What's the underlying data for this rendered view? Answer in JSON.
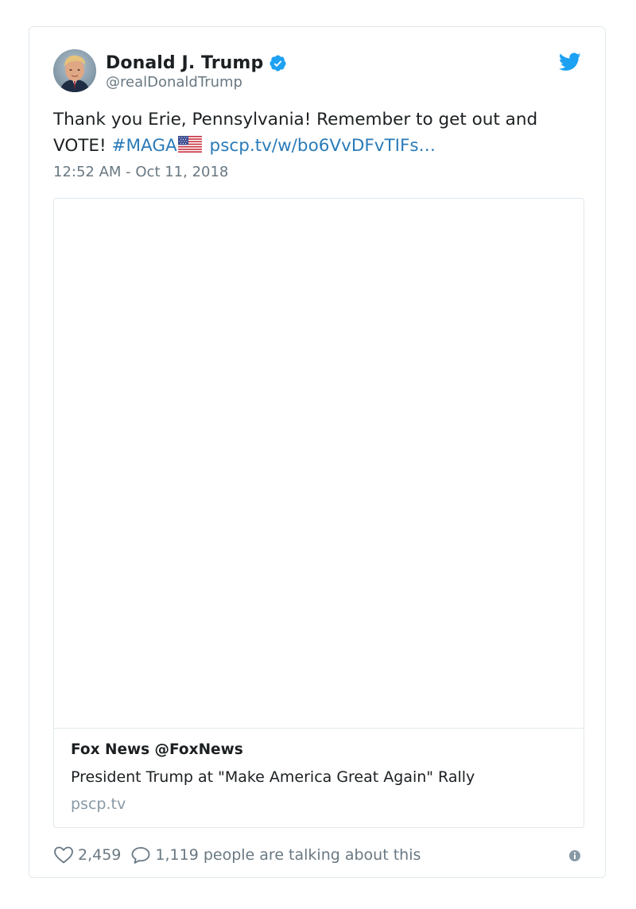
{
  "tweet": {
    "author": {
      "display_name": "Donald J. Trump",
      "screen_name": "@realDonaldTrump",
      "verified": true
    },
    "text_part1": "Thank you Erie, Pennsylvania! Remember to get out and VOTE! ",
    "hashtag": "#MAGA",
    "flag_icon": "us-flag-icon",
    "link_text": "pscp.tv/w/bo6VvDFvTIFs…",
    "timestamp": "12:52 AM - Oct 11, 2018",
    "card": {
      "author": "Fox News @FoxNews",
      "title": "President Trump at \"Make America Great Again\" Rally",
      "domain": "pscp.tv"
    },
    "footer": {
      "like_count": "2,459",
      "talking_text": "1,119 people are talking about this"
    }
  },
  "colors": {
    "link": "#2b7bb9",
    "verified": "#1da1f2",
    "twitter_brand": "#1da1f2",
    "secondary_text": "#697882",
    "border": "#e1e8ed"
  },
  "icons": [
    "verified-badge-icon",
    "twitter-bird-icon",
    "heart-icon",
    "comment-icon",
    "info-icon"
  ]
}
